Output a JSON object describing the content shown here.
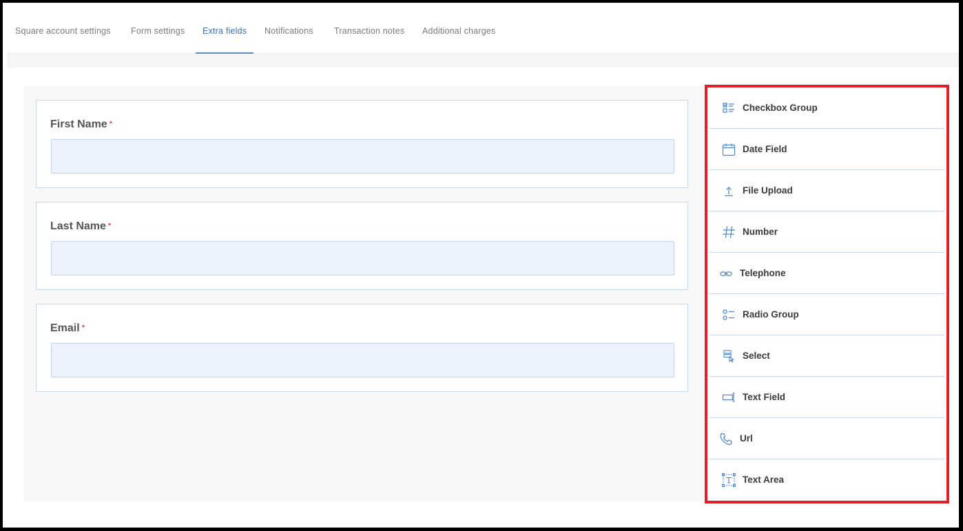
{
  "tabs": [
    {
      "label": "Square account settings"
    },
    {
      "label": "Form settings"
    },
    {
      "label": "Extra fields"
    },
    {
      "label": "Notifications"
    },
    {
      "label": "Transaction notes"
    },
    {
      "label": "Additional charges"
    }
  ],
  "active_tab": "Extra fields",
  "form": {
    "fields": [
      {
        "label": "First Name",
        "required_mark": "*",
        "value": ""
      },
      {
        "label": "Last Name",
        "required_mark": "*",
        "value": ""
      },
      {
        "label": "Email",
        "required_mark": "*",
        "value": ""
      }
    ]
  },
  "palette": {
    "highlight_color": "#e41e26",
    "icon_color": "#4a86d0",
    "items": [
      {
        "label": "Checkbox Group",
        "icon": "checkbox-group-icon"
      },
      {
        "label": "Date Field",
        "icon": "calendar-icon"
      },
      {
        "label": "File Upload",
        "icon": "upload-icon"
      },
      {
        "label": "Number",
        "icon": "hash-icon"
      },
      {
        "label": "Telephone",
        "icon": "link-icon"
      },
      {
        "label": "Radio Group",
        "icon": "radio-group-icon"
      },
      {
        "label": "Select",
        "icon": "select-icon"
      },
      {
        "label": "Text Field",
        "icon": "text-field-icon"
      },
      {
        "label": "Url",
        "icon": "phone-icon"
      },
      {
        "label": "Text Area",
        "icon": "text-area-icon"
      }
    ]
  }
}
